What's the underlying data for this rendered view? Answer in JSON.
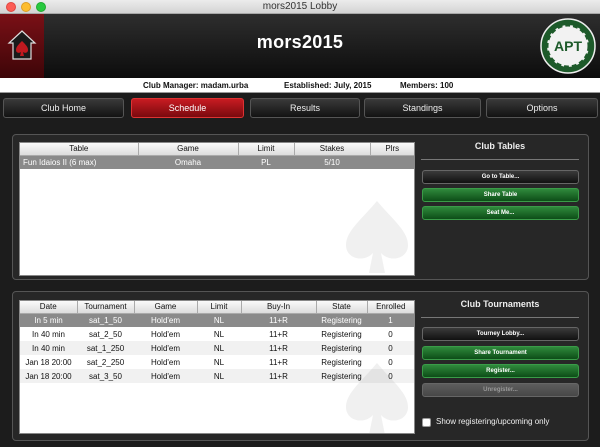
{
  "window": {
    "title": "mors2015 Lobby"
  },
  "header": {
    "club_name": "mors2015",
    "logo_text": "APT"
  },
  "info": {
    "manager": "Club Manager: madam.urba",
    "established": "Established: July, 2015",
    "members": "Members: 100"
  },
  "nav": [
    {
      "label": "Club Home",
      "active": false
    },
    {
      "label": "Schedule",
      "active": true
    },
    {
      "label": "Results",
      "active": false
    },
    {
      "label": "Standings",
      "active": false
    },
    {
      "label": "Options",
      "active": false
    }
  ],
  "tables": {
    "columns": [
      "Table",
      "Game",
      "Limit",
      "Stakes",
      "Plrs"
    ],
    "rows": [
      [
        "Fun Idaios II (6 max)",
        "Omaha",
        "PL",
        "5/10",
        ""
      ]
    ]
  },
  "club_tables": {
    "title": "Club Tables",
    "buttons": [
      "Go to Table...",
      "Share Table",
      "Seat Me..."
    ]
  },
  "tournaments": {
    "columns": [
      "Date",
      "Tournament",
      "Game",
      "Limit",
      "Buy-In",
      "State",
      "Enrolled"
    ],
    "rows": [
      [
        "In 5 min",
        "sat_1_50",
        "Hold'em",
        "NL",
        "11+R",
        "Registering",
        "1"
      ],
      [
        "In 40 min",
        "sat_2_50",
        "Hold'em",
        "NL",
        "11+R",
        "Registering",
        "0"
      ],
      [
        "In 40 min",
        "sat_1_250",
        "Hold'em",
        "NL",
        "11+R",
        "Registering",
        "0"
      ],
      [
        "Jan 18  20:00",
        "sat_2_250",
        "Hold'em",
        "NL",
        "11+R",
        "Registering",
        "0"
      ],
      [
        "Jan 18  20:00",
        "sat_3_50",
        "Hold'em",
        "NL",
        "11+R",
        "Registering",
        "0"
      ]
    ]
  },
  "club_tournaments": {
    "title": "Club Tournaments",
    "buttons": [
      "Tourney Lobby...",
      "Share Tournament",
      "Register...",
      "Unregister..."
    ],
    "checkbox_label": "Show registering/upcoming only"
  },
  "colors": {
    "accent_red": "#b3141a",
    "green": "#1f6b2b"
  }
}
